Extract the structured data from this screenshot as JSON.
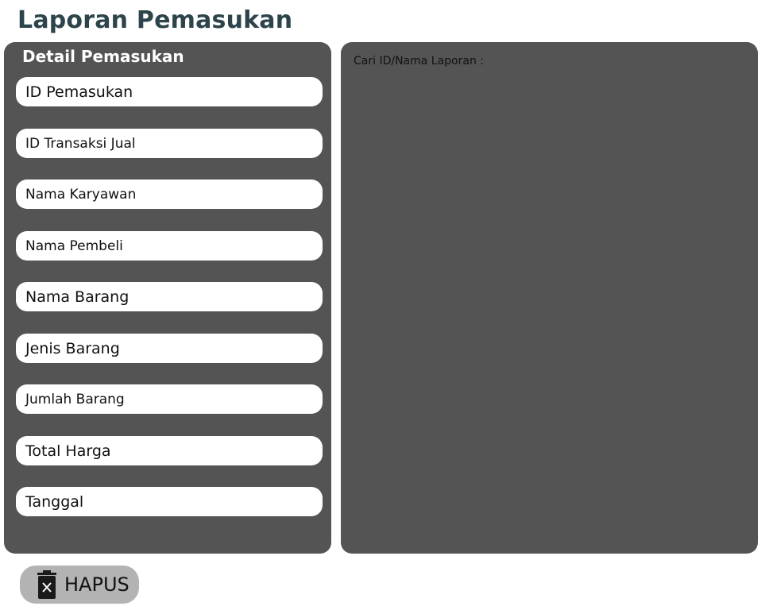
{
  "page": {
    "title": "Laporan Pemasukan"
  },
  "detail_panel": {
    "title": "Detail Pemasukan",
    "fields": [
      {
        "name": "id-pemasukan-field",
        "label": "ID Pemasukan"
      },
      {
        "name": "id-transaksi-jual-field",
        "label": "ID Transaksi Jual"
      },
      {
        "name": "nama-karyawan-field",
        "label": "Nama Karyawan"
      },
      {
        "name": "nama-pembeli-field",
        "label": "Nama Pembeli"
      },
      {
        "name": "nama-barang-field",
        "label": "Nama Barang"
      },
      {
        "name": "jenis-barang-field",
        "label": "Jenis Barang"
      },
      {
        "name": "jumlah-barang-field",
        "label": "Jumlah Barang"
      },
      {
        "name": "total-harga-field",
        "label": "Total Harga"
      },
      {
        "name": "tanggal-field",
        "label": "Tanggal"
      }
    ]
  },
  "report_panel": {
    "search_label": "Cari ID/Nama Laporan :"
  },
  "actions": {
    "delete_label": "HAPUS",
    "delete_icon": "trash-icon"
  },
  "colors": {
    "title": "#2c444a",
    "panel_bg": "#545454",
    "field_bg": "#ffffff",
    "button_bg": "#b3b3b3"
  }
}
